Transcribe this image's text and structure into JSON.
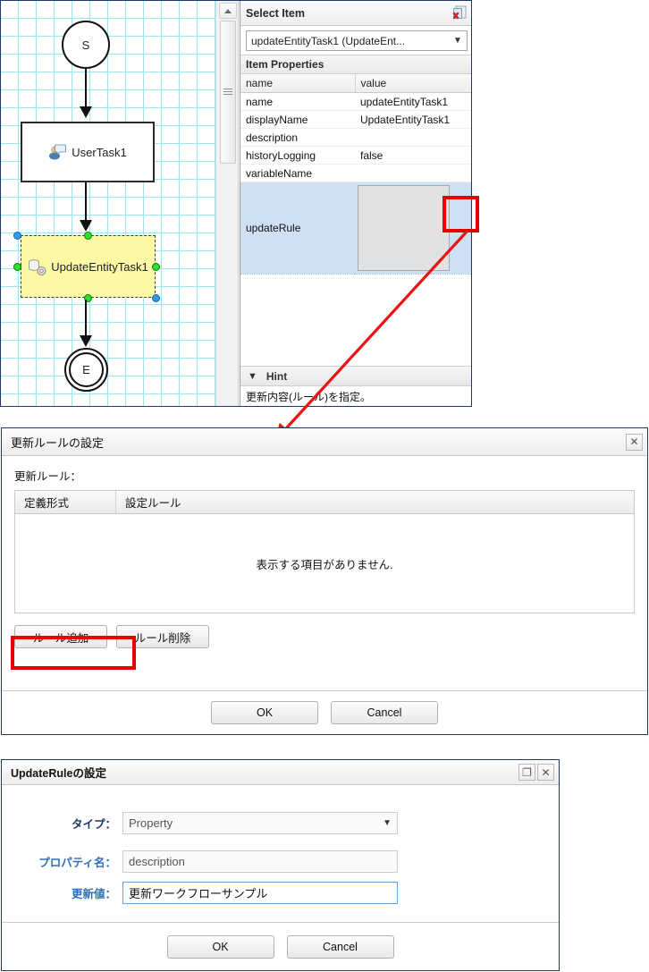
{
  "editor": {
    "canvas": {
      "nodes": [
        {
          "id": "start",
          "label": "S",
          "type": "start-event"
        },
        {
          "id": "usertask1",
          "label": "UserTask1",
          "type": "user-task",
          "icon": "user-task-icon"
        },
        {
          "id": "updateentitytask1",
          "label": "UpdateEntityTask1",
          "type": "update-entity-task",
          "icon": "update-entity-icon",
          "selected": true
        },
        {
          "id": "end",
          "label": "E",
          "type": "end-event"
        }
      ]
    },
    "properties_panel": {
      "title": "Select Item",
      "close_icon": "document-delete-icon",
      "selected_item": "updateEntityTask1 (UpdateEnt...",
      "section_title": "Item Properties",
      "columns": [
        "name",
        "value"
      ],
      "rows": [
        {
          "name": "name",
          "value": "updateEntityTask1"
        },
        {
          "name": "displayName",
          "value": "UpdateEntityTask1"
        },
        {
          "name": "description",
          "value": ""
        },
        {
          "name": "historyLogging",
          "value": "false"
        },
        {
          "name": "variableName",
          "value": ""
        }
      ],
      "selected_row": {
        "name": "updateRule",
        "value": "",
        "ellipsis_button": "..."
      },
      "hint": {
        "title": "Hint",
        "text": "更新内容(ルール)を指定。"
      }
    }
  },
  "dialog_update_rule_list": {
    "title": "更新ルールの設定",
    "close_label": "✕",
    "field_label": "更新ルール：",
    "columns": [
      "定義形式",
      "設定ルール"
    ],
    "empty_message": "表示する項目がありません.",
    "buttons": {
      "add": "ルール追加",
      "delete": "ルール削除"
    },
    "footer": {
      "ok": "OK",
      "cancel": "Cancel"
    }
  },
  "dialog_update_rule_edit": {
    "title": "UpdateRuleの設定",
    "maximize_label": "❐",
    "close_label": "✕",
    "fields": [
      {
        "label": "タイプ：",
        "value": "Property",
        "control": "select",
        "style": "dark"
      },
      {
        "label": "プロパティ名：",
        "value": "description",
        "control": "text",
        "style": "blue"
      },
      {
        "label": "更新値：",
        "value": "更新ワークフローサンプル",
        "control": "text",
        "style": "blue",
        "focused": true
      }
    ],
    "footer": {
      "ok": "OK",
      "cancel": "Cancel"
    }
  },
  "annotations": {
    "highlight_color": "#e60000",
    "arrow1": "points from ellipsis button to 更新ルールの設定 dialog",
    "arrow2": "points from ルール追加 button to UpdateRuleの設定 dialog"
  }
}
